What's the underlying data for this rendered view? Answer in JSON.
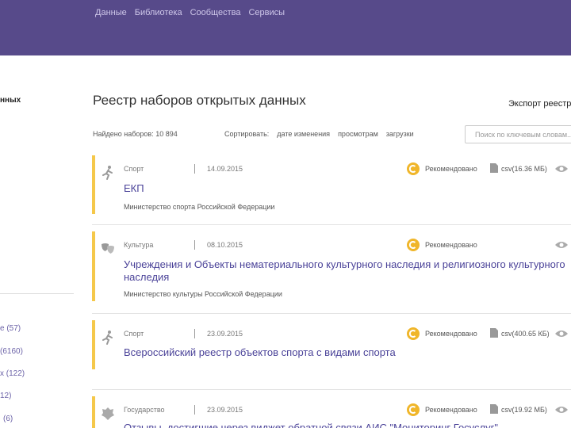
{
  "header": {
    "nav": [
      "Данные",
      "Библиотека",
      "Сообщества",
      "Сервисы"
    ],
    "bg_color": "#574a8a"
  },
  "sidebar": {
    "title": "нных",
    "items": [
      {
        "label": "е (57)"
      },
      {
        "label": "(6160)"
      },
      {
        "label": "х (122)"
      },
      {
        "label": "12)"
      },
      {
        "label": "(6)"
      }
    ]
  },
  "main": {
    "title": "Реестр наборов открытых данных",
    "export_label": "Экспорт реестр",
    "found_text": "Найдено наборов: 10 894",
    "sort_label": "Сортировать:",
    "sort_options": [
      "дате изменения",
      "просмотрам",
      "загрузки"
    ],
    "search_placeholder": "Поиск по ключевым словам..."
  },
  "datasets": [
    {
      "category": "Спорт",
      "category_icon": "runner-icon",
      "date": "14.09.2015",
      "recommended": "Рекомендовано",
      "file": "csv(16.36 МБ)",
      "title_lines": [
        "ЕКП"
      ],
      "org": "Министерство спорта Российской Федерации"
    },
    {
      "category": "Культура",
      "category_icon": "theater-masks-icon",
      "date": "08.10.2015",
      "recommended": "Рекомендовано",
      "file": "",
      "title_lines": [
        "Учреждения и Объекты нематериального культурного наследия и религиозного культурного",
        "наследия"
      ],
      "org": "Министерство культуры Российской Федерации"
    },
    {
      "category": "Спорт",
      "category_icon": "runner-icon",
      "date": "23.09.2015",
      "recommended": "Рекомендовано",
      "file": "csv(400.65 КБ)",
      "title_lines": [
        "Всероссийский реестр объектов спорта с видами спорта"
      ],
      "org": ""
    },
    {
      "category": "Государство",
      "category_icon": "coat-of-arms-icon",
      "date": "23.09.2015",
      "recommended": "Рекомендовано",
      "file": "csv(19.92 МБ)",
      "title_lines": [
        "Отзывы, достигшие через виджет обратной связи АИС \"Мониторинг Госуслуг\""
      ],
      "org": ""
    }
  ],
  "colors": {
    "accent_bar": "#f5c84a",
    "link": "#4b4399",
    "recommended_badge": "#f0b62a"
  }
}
